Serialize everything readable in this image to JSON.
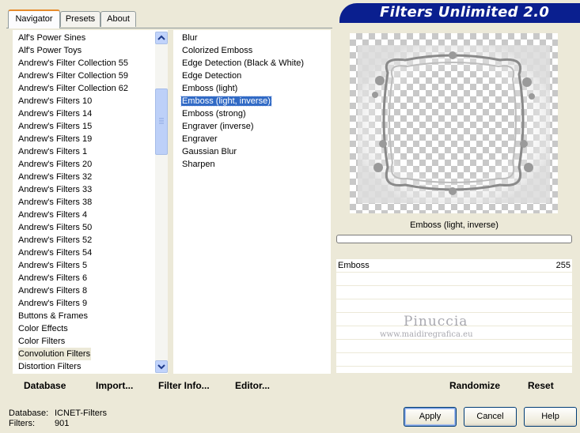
{
  "tabs": [
    {
      "label": "Navigator",
      "active": true
    },
    {
      "label": "Presets",
      "active": false
    },
    {
      "label": "About",
      "active": false
    }
  ],
  "app_title": "Filters Unlimited 2.0",
  "categories": [
    "Alf's Power Sines",
    "Alf's Power Toys",
    "Andrew's Filter Collection 55",
    "Andrew's Filter Collection 59",
    "Andrew's Filter Collection 62",
    "Andrew's Filters 10",
    "Andrew's Filters 14",
    "Andrew's Filters 15",
    "Andrew's Filters 19",
    "Andrew's Filters 1",
    "Andrew's Filters 20",
    "Andrew's Filters 32",
    "Andrew's Filters 33",
    "Andrew's Filters 38",
    "Andrew's Filters 4",
    "Andrew's Filters 50",
    "Andrew's Filters 52",
    "Andrew's Filters 54",
    "Andrew's Filters 5",
    "Andrew's Filters 6",
    "Andrew's Filters 8",
    "Andrew's Filters 9",
    "Buttons & Frames",
    "Color Effects",
    "Color Filters",
    "Convolution Filters",
    "Distortion Filters"
  ],
  "selected_category": "Convolution Filters",
  "filters": [
    "Blur",
    "Colorized Emboss",
    "Edge Detection (Black & White)",
    "Edge Detection",
    "Emboss (light)",
    "Emboss (light, inverse)",
    "Emboss (strong)",
    "Engraver (inverse)",
    "Engraver",
    "Gaussian Blur",
    "Sharpen"
  ],
  "selected_filter": "Emboss (light, inverse)",
  "left_buttons": {
    "database": "Database",
    "import": "Import...",
    "filter_info": "Filter Info...",
    "editor": "Editor..."
  },
  "preview_filter_name": "Emboss (light, inverse)",
  "progress": 0,
  "params": [
    {
      "name": "Emboss",
      "value": "255"
    }
  ],
  "right_buttons": {
    "randomize": "Randomize",
    "reset": "Reset"
  },
  "watermark": {
    "name": "Pinuccia",
    "url": "www.maidiregrafica.eu"
  },
  "status": {
    "database_label": "Database:",
    "database_value": "ICNET-Filters",
    "filters_label": "Filters:",
    "filters_value": "901"
  },
  "dialog_buttons": {
    "apply": "Apply",
    "cancel": "Cancel",
    "help": "Help"
  }
}
